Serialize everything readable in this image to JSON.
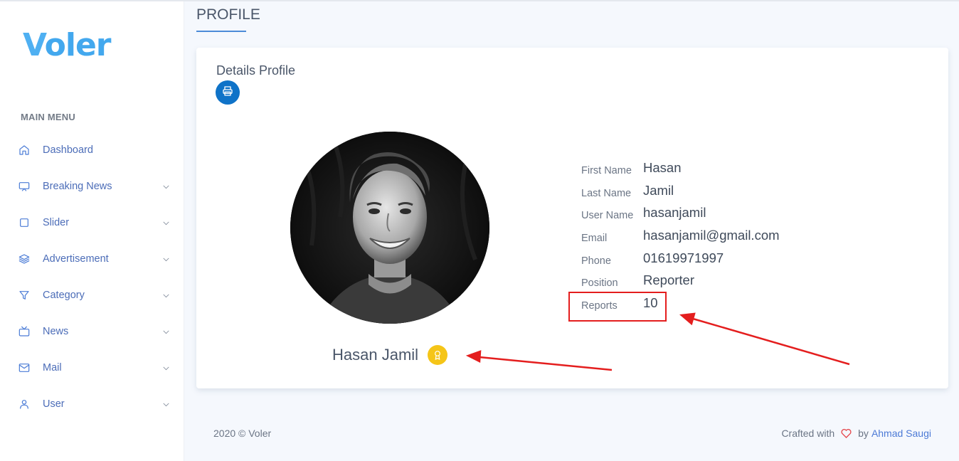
{
  "app": {
    "logo_first": "V",
    "logo_rest": "oler"
  },
  "sidebar": {
    "menu_title": "MAIN MENU",
    "items": [
      {
        "label": "Dashboard",
        "icon": "home-icon",
        "has_submenu": false
      },
      {
        "label": "Breaking News",
        "icon": "monitor-icon",
        "has_submenu": true
      },
      {
        "label": "Slider",
        "icon": "square-icon",
        "has_submenu": true
      },
      {
        "label": "Advertisement",
        "icon": "layers-icon",
        "has_submenu": true
      },
      {
        "label": "Category",
        "icon": "filter-icon",
        "has_submenu": true
      },
      {
        "label": "News",
        "icon": "tv-icon",
        "has_submenu": true
      },
      {
        "label": "Mail",
        "icon": "mail-icon",
        "has_submenu": true
      },
      {
        "label": "User",
        "icon": "user-icon",
        "has_submenu": true
      }
    ]
  },
  "page": {
    "title": "PROFILE"
  },
  "card": {
    "title": "Details Profile",
    "print_icon": "printer-icon",
    "profile_name": "Hasan Jamil",
    "badge_icon": "award-icon",
    "details": [
      {
        "label": "First Name",
        "value": "Hasan"
      },
      {
        "label": "Last Name",
        "value": "Jamil"
      },
      {
        "label": "User Name",
        "value": "hasanjamil"
      },
      {
        "label": "Email",
        "value": "hasanjamil@gmail.com"
      },
      {
        "label": "Phone",
        "value": "01619971997"
      },
      {
        "label": "Position",
        "value": "Reporter"
      },
      {
        "label": "Reports",
        "value": "10"
      }
    ]
  },
  "footer": {
    "copyright": "2020 © Voler",
    "crafted": "Crafted with",
    "by": "by",
    "author": "Ahmad Saugi"
  },
  "colors": {
    "accent": "#0f73c8",
    "link": "#4c7ad6",
    "annotation": "#e41e1e",
    "badge": "#f5c518"
  }
}
